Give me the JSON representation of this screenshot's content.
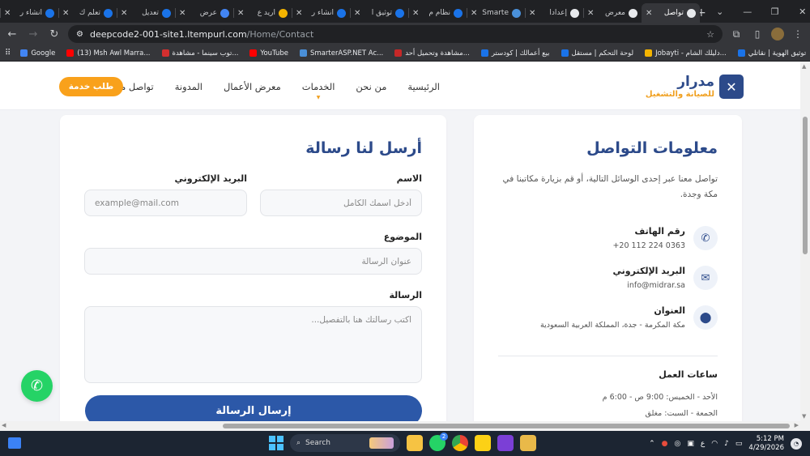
{
  "browser": {
    "tabs": [
      {
        "label": "تواصل",
        "active": true,
        "favicon_color": "#e8eaed"
      },
      {
        "label": "معرض",
        "active": false,
        "favicon_color": "#e8eaed"
      },
      {
        "label": "إعدادا",
        "active": false,
        "favicon_color": "#e8eaed"
      },
      {
        "label": "Smarte",
        "active": false,
        "favicon_color": "#4a90d9"
      },
      {
        "label": "نظام م",
        "active": false,
        "favicon_color": "#1a73e8"
      },
      {
        "label": "توثيق ا",
        "active": false,
        "favicon_color": "#1a73e8"
      },
      {
        "label": "انشاء ر",
        "active": false,
        "favicon_color": "#1a73e8"
      },
      {
        "label": "اريد ع",
        "active": false,
        "favicon_color": "#f4b400"
      },
      {
        "label": "عرض",
        "active": false,
        "favicon_color": "#4285f4"
      },
      {
        "label": "تعديل",
        "active": false,
        "favicon_color": "#1a73e8"
      },
      {
        "label": "تعلم ك",
        "active": false,
        "favicon_color": "#1a73e8"
      },
      {
        "label": "انشاء ر",
        "active": false,
        "favicon_color": "#1a73e8"
      }
    ],
    "new_tab_symbol": "+",
    "window_controls": [
      "⌄",
      "—",
      "❐",
      "✕"
    ],
    "url_host": "deepcode2-001-site1.ltempurl.com",
    "url_path": "/Home/Contact",
    "bookmarks": [
      {
        "label": "Google",
        "color": "#4285f4"
      },
      {
        "label": "(13) Msh Awl Marra...",
        "color": "#ff0000"
      },
      {
        "label": "توب سينما - مشاهدة...",
        "color": "#d32f2f"
      },
      {
        "label": "YouTube",
        "color": "#ff0000"
      },
      {
        "label": "SmarterASP.NET Ac...",
        "color": "#4a90d9"
      },
      {
        "label": "مشاهدة وتحميل أحد...",
        "color": "#c62828"
      },
      {
        "label": "بيع أعمالك | كودستر",
        "color": "#1a73e8"
      },
      {
        "label": "لوحة التحكم | مستقل",
        "color": "#1a73e8"
      },
      {
        "label": "Jobayti - دليلك الشام...",
        "color": "#f4b400"
      },
      {
        "label": "توثيق الهوية | نقاتلي",
        "color": "#1a73e8"
      }
    ]
  },
  "site": {
    "logo_name": "مدرار",
    "logo_sub": "للصيانة والتشغيل",
    "nav": [
      "الرئيسية",
      "من نحن",
      "الخدمات",
      "معرض الأعمال",
      "المدونة",
      "تواصل معنا"
    ],
    "cta": "طلب خدمة"
  },
  "info": {
    "title": "معلومات التواصل",
    "intro": "تواصل معنا عبر إحدى الوسائل التالية، أو قم بزيارة مكاتبنا في مكة وجدة.",
    "phone_label": "رقم الهاتف",
    "phone_value": "+20 112 224 0363",
    "email_label": "البريد الإلكتروني",
    "email_value": "info@midrar.sa",
    "address_label": "العنوان",
    "address_value": "مكة المكرمة - جدة، المملكة العربية السعودية",
    "hours_title": "ساعات العمل",
    "hours_weekdays": "الأحد - الخميس: 9:00 ص - 6:00 م",
    "hours_weekend": "الجمعة - السبت: مغلق"
  },
  "form": {
    "title": "أرسل لنا رسالة",
    "name_label": "الاسم",
    "name_placeholder": "أدخل اسمك الكامل",
    "email_label": "البريد الإلكتروني",
    "email_placeholder": "example@mail.com",
    "subject_label": "الموضوع",
    "subject_placeholder": "عنوان الرسالة",
    "message_label": "الرسالة",
    "message_placeholder": "اكتب رسالتك هنا بالتفصيل...",
    "submit": "إرسال الرسالة"
  },
  "taskbar": {
    "search_label": "Search",
    "whatsapp_badge": "2",
    "language": "ع",
    "time": "5:12 PM",
    "date": "4/29/2026"
  }
}
